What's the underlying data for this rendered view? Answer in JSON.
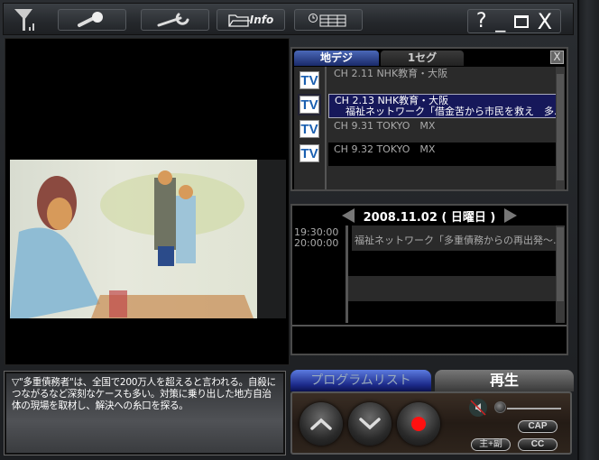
{
  "toolbar": {
    "signal_icon": "antenna-signal",
    "search_icon": "magnifier",
    "settings_icon": "wrench",
    "info_label": "Info",
    "epg_icon": "clock-grid",
    "help_label": "?",
    "minimize_label": "_",
    "close_label": "X"
  },
  "channel_panel": {
    "tabs": [
      {
        "label": "地デジ",
        "active": true
      },
      {
        "label": "1セグ",
        "active": false
      }
    ],
    "close_label": "X",
    "channels": [
      {
        "icon": "TV",
        "name": "CH 2.11 NHK教育・大阪",
        "program": "",
        "selected": false
      },
      {
        "icon": "TV",
        "name": "CH 2.13 NHK教育・大阪",
        "program": "福祉ネットワーク「借金苦から市民を救え　多..",
        "selected": true
      },
      {
        "icon": "TV",
        "name": "CH 9.31 TOKYO　MX",
        "program": "",
        "selected": false
      },
      {
        "icon": "TV",
        "name": "CH 9.32 TOKYO　MX",
        "program": "",
        "selected": false
      }
    ]
  },
  "epg": {
    "date": "2008.11.02 ( 日曜日 )",
    "start_time": "19:30:00",
    "end_time": "20:00:00",
    "program": "福祉ネットワーク「多重債務からの再出発～.."
  },
  "description": "▽\"多重債務者\"は、全国で200万人を超えると言われる。自殺につながるなど深刻なケースも多い。対策に乗り出した地方自治体の現場を取材し、解決への糸口を探る。",
  "controls": {
    "tab_program_list": "プログラムリスト",
    "tab_play": "再生",
    "up_label": "︿",
    "down_label": "﹀",
    "mute_icon": "speaker-muted",
    "volume_level": 0,
    "cap_label": "CAP",
    "audio_label": "主+副",
    "cc_label": "CC"
  }
}
